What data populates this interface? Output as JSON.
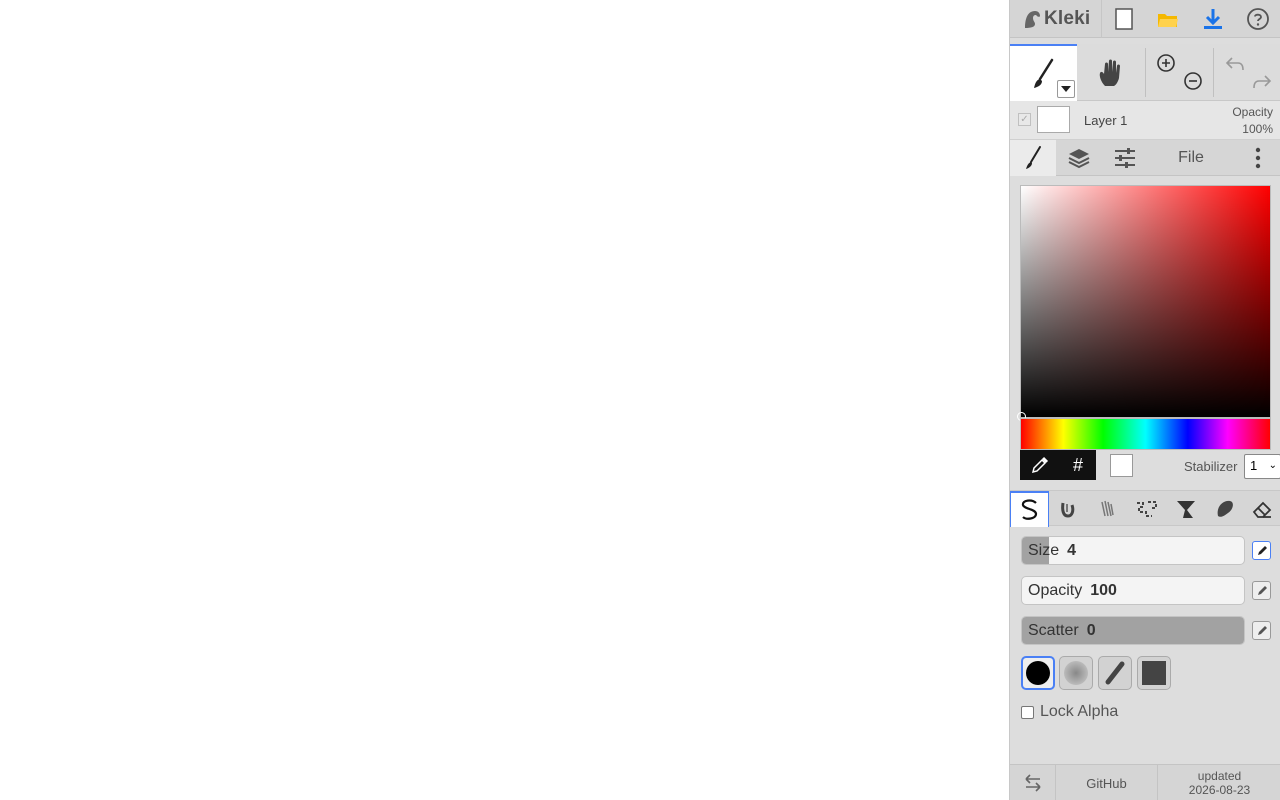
{
  "app": {
    "name": "Kleki"
  },
  "header": {
    "icons": [
      "new-image-icon",
      "open-folder-icon",
      "download-icon",
      "help-icon"
    ],
    "folder_color": "#f5b800",
    "download_color": "#1a73e8"
  },
  "tools": {
    "icons": [
      "brush-tool-icon",
      "hand-tool-icon",
      "zoom-in-icon",
      "zoom-out-icon",
      "undo-icon",
      "redo-icon"
    ]
  },
  "layer": {
    "name": "Layer 1",
    "opacity_label": "Opacity",
    "opacity_value": "100%"
  },
  "tabs": {
    "file_label": "File"
  },
  "color": {
    "hue_color": "#ff0000",
    "hash_label": "#",
    "current_color": "#ffffff",
    "stabilizer_label": "Stabilizer",
    "stabilizer_value": "1"
  },
  "brushes": [
    "pen-brush-icon",
    "blend-brush-icon",
    "sketchy-brush-icon",
    "pixel-brush-icon",
    "chemy-brush-icon",
    "smudge-brush-icon",
    "eraser-brush-icon"
  ],
  "sliders": {
    "size": {
      "label": "Size",
      "value": "4",
      "fill": 0.12
    },
    "opacity": {
      "label": "Opacity",
      "value": "100",
      "fill": 0.0
    },
    "scatter": {
      "label": "Scatter",
      "value": "0",
      "fill": 1.0
    }
  },
  "lock_alpha_label": "Lock Alpha",
  "footer": {
    "github": "GitHub",
    "updated_label": "updated",
    "updated_date": "2026-08-23"
  },
  "accent_color": "#4a80f5"
}
